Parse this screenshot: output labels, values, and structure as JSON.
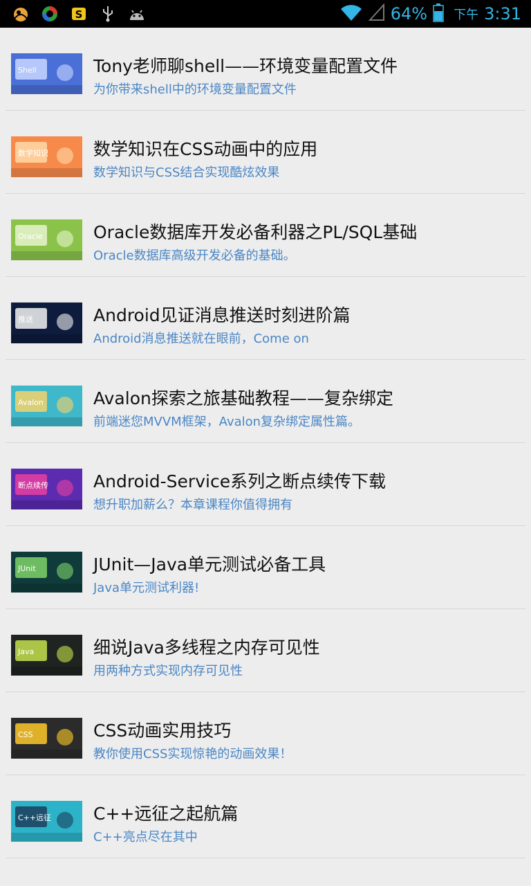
{
  "status_bar": {
    "battery_percent": "64%",
    "ampm": "下午",
    "time": "3:31",
    "left_icons": [
      "uc-browser-icon",
      "circle-app-icon",
      "s-app-icon",
      "usb-icon",
      "android-debug-icon"
    ],
    "right_icons": [
      "wifi-icon",
      "signal-icon",
      "battery-icon"
    ]
  },
  "courses": [
    {
      "title": "Tony老师聊shell——环境变量配置文件",
      "subtitle": "为你带来shell中的环境变量配置文件",
      "thumb": {
        "bg": "#4a6fd6",
        "accent": "#c9d7ff",
        "text": "Shell"
      }
    },
    {
      "title": "数学知识在CSS动画中的应用",
      "subtitle": "数学知识与CSS结合实现酷炫效果",
      "thumb": {
        "bg": "#f78a4a",
        "accent": "#ffd9a8",
        "text": "数学知识"
      }
    },
    {
      "title": "Oracle数据库开发必备利器之PL/SQL基础",
      "subtitle": "Oracle数据库高级开发必备的基础。",
      "thumb": {
        "bg": "#8bc34a",
        "accent": "#e6f5cf",
        "text": "Oracle"
      }
    },
    {
      "title": "Android见证消息推送时刻进阶篇",
      "subtitle": "Android消息推送就在眼前，Come on",
      "thumb": {
        "bg": "#0d1b3d",
        "accent": "#f2f2f2",
        "text": "推送"
      }
    },
    {
      "title": "Avalon探索之旅基础教程——复杂绑定",
      "subtitle": "前端迷您MVVM框架，Avalon复杂绑定属性篇。",
      "thumb": {
        "bg": "#3fb8c9",
        "accent": "#f5d26a",
        "text": "Avalon"
      }
    },
    {
      "title": "Android-Service系列之断点续传下载",
      "subtitle": "想升职加薪么？本章课程你值得拥有",
      "thumb": {
        "bg": "#5b2bb0",
        "accent": "#e93fa0",
        "text": "断点续传"
      }
    },
    {
      "title": "JUnit—Java单元测试必备工具",
      "subtitle": "Java单元测试利器!",
      "thumb": {
        "bg": "#0f3b3a",
        "accent": "#7fd36a",
        "text": "JUnit"
      }
    },
    {
      "title": "细说Java多线程之内存可见性",
      "subtitle": "用两种方式实现内存可见性",
      "thumb": {
        "bg": "#1f2420",
        "accent": "#c6e24d",
        "text": "Java"
      }
    },
    {
      "title": "CSS动画实用技巧",
      "subtitle": "教你使用CSS实现惊艳的动画效果！",
      "thumb": {
        "bg": "#2b2b2b",
        "accent": "#ffc928",
        "text": "CSS"
      }
    },
    {
      "title": "C++远征之起航篇",
      "subtitle": "C++亮点尽在其中",
      "thumb": {
        "bg": "#2cb3c8",
        "accent": "#1c3d5c",
        "text": "C++远征"
      }
    }
  ]
}
